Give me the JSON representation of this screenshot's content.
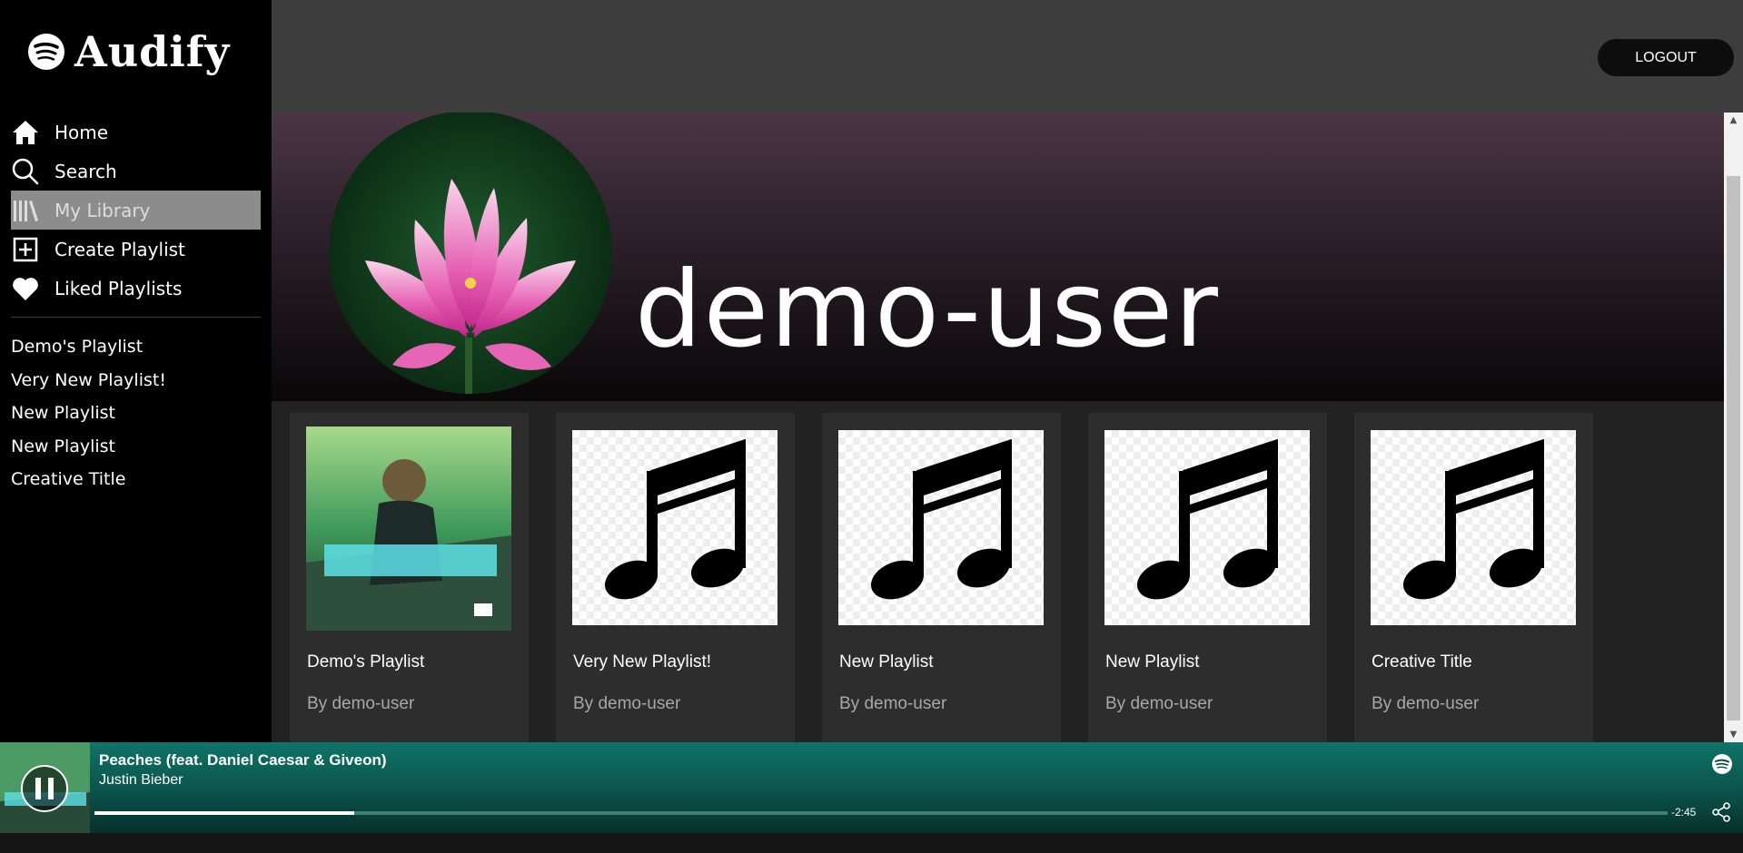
{
  "app": {
    "name": "Audify",
    "logo_icon": "spotify-logo-icon"
  },
  "sidebar": {
    "nav": [
      {
        "label": "Home",
        "icon": "home-icon"
      },
      {
        "label": "Search",
        "icon": "search-icon"
      },
      {
        "label": "My Library",
        "icon": "library-icon",
        "active": true
      },
      {
        "label": "Create Playlist",
        "icon": "plus-square-icon"
      },
      {
        "label": "Liked Playlists",
        "icon": "heart-icon"
      }
    ],
    "playlists": [
      "Demo's Playlist",
      "Very New Playlist!",
      "New Playlist",
      "New Playlist",
      "Creative Title"
    ]
  },
  "header": {
    "logout_label": "LOGOUT"
  },
  "profile": {
    "username": "demo-user",
    "avatar": "lotus-flower-image"
  },
  "cards": [
    {
      "title": "Demo's Playlist",
      "by": "By demo-user",
      "art": "album-cover-photo"
    },
    {
      "title": "Very New Playlist!",
      "by": "By demo-user",
      "art": "music-note-icon"
    },
    {
      "title": "New Playlist",
      "by": "By demo-user",
      "art": "music-note-icon"
    },
    {
      "title": "New Playlist",
      "by": "By demo-user",
      "art": "music-note-icon"
    },
    {
      "title": "Creative Title",
      "by": "By demo-user",
      "art": "music-note-icon"
    }
  ],
  "player": {
    "title": "Peaches (feat. Daniel Caesar & Giveon)",
    "artist": "Justin Bieber",
    "time_remaining": "-2:45",
    "progress": 0.165,
    "state_icon": "pause-icon",
    "accent": "#0f7468"
  }
}
